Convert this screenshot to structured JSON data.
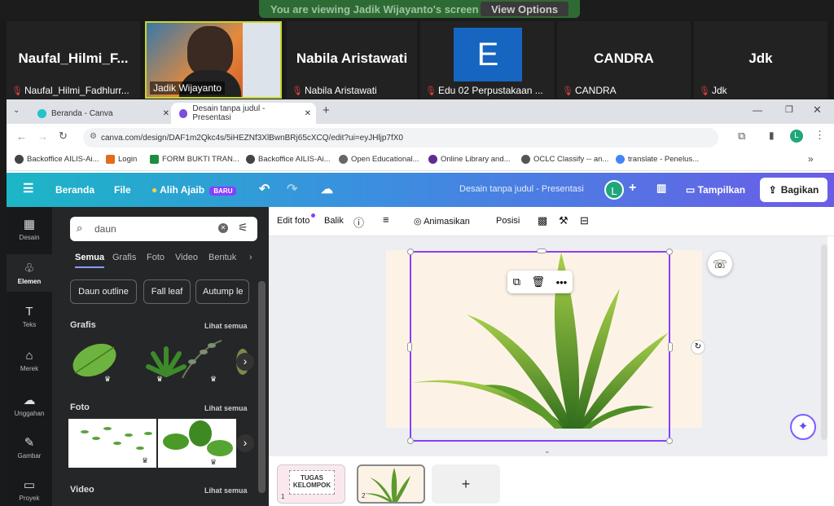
{
  "zoom": {
    "banner_text": "You are viewing Jadik Wijayanto's screen",
    "view_options": "View Options"
  },
  "participants": [
    {
      "display": "Naufal_Hilmi_F...",
      "label": "Naufal_Hilmi_Fadhlurr..."
    },
    {
      "display": "",
      "label": "Jadik Wijayanto"
    },
    {
      "display": "Nabila Aristawati",
      "label": "Nabila Aristawati"
    },
    {
      "display": "E",
      "label": "Edu 02 Perpustakaan ..."
    },
    {
      "display": "CANDRA",
      "label": "CANDRA"
    },
    {
      "display": "Jdk",
      "label": "Jdk"
    }
  ],
  "browser": {
    "tabs": [
      {
        "label": "Beranda - Canva"
      },
      {
        "label": "Desain tanpa judul - Presentasi"
      }
    ],
    "new_tab": "+",
    "url": "canva.com/design/DAF1m2Qkc4s/5iHEZNf3XlBwnBRj65cXCQ/edit?ui=eyJHljp7fX0",
    "profile": "L",
    "bookmarks": [
      "Backoffice AILIS-Ai...",
      "Login",
      "FORM BUKTI TRAN...",
      "Backoffice AILIS-Ai...",
      "Open Educational...",
      "Online Library and...",
      "OCLC Classify -- an...",
      "translate - Penelus..."
    ]
  },
  "canva_header": {
    "home": "Beranda",
    "file": "File",
    "magic": "Alih Ajaib",
    "badge": "BARU",
    "doc_title": "Desain tanpa judul - Presentasi",
    "avatar": "L",
    "present": "Tampilkan",
    "share": "Bagikan"
  },
  "rail": [
    "Desain",
    "Elemen",
    "Teks",
    "Merek",
    "Unggahan",
    "Gambar",
    "Proyek"
  ],
  "panel": {
    "search_value": "daun",
    "tabs": [
      "Semua",
      "Grafis",
      "Foto",
      "Video",
      "Bentuk"
    ],
    "chips": [
      "Daun outline",
      "Fall leaf",
      "Autump le"
    ],
    "sections": [
      {
        "title": "Grafis",
        "link": "Lihat semua"
      },
      {
        "title": "Foto",
        "link": "Lihat semua"
      },
      {
        "title": "Video",
        "link": "Lihat semua"
      }
    ]
  },
  "toolbar": {
    "edit_photo": "Edit foto",
    "flip": "Balik",
    "animate": "Animasikan",
    "position": "Posisi"
  },
  "pages": [
    {
      "number": "1",
      "title": "TUGAS KELOMPOK"
    },
    {
      "number": "2"
    }
  ],
  "add_page": "+",
  "colors": {
    "accent": "#8b3dff",
    "zoom_green": "#2e6b34",
    "panel_bg": "#252627"
  }
}
